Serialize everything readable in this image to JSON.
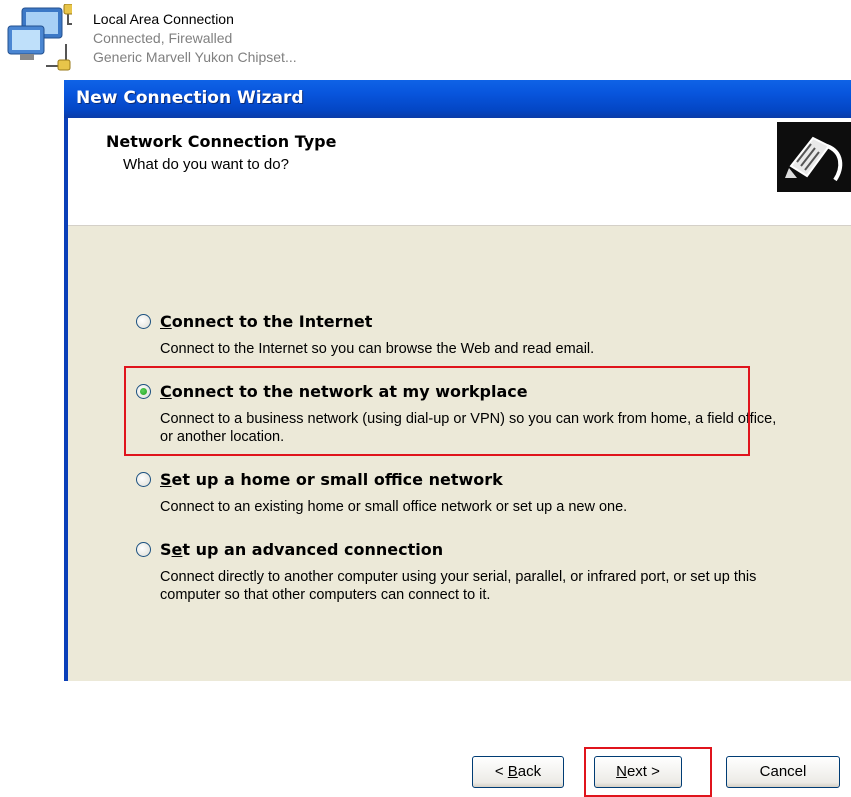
{
  "connection": {
    "name": "Local Area Connection",
    "status": "Connected, Firewalled",
    "adapter": "Generic Marvell Yukon Chipset..."
  },
  "wizard": {
    "title": "New Connection Wizard",
    "header_title": "Network Connection Type",
    "header_subtitle": "What do you want to do?",
    "options": [
      {
        "label_pre": "",
        "label_key": "C",
        "label_post": "onnect to the Internet",
        "desc": "Connect to the Internet so you can browse the Web and read email.",
        "selected": false
      },
      {
        "label_pre": "",
        "label_key": "C",
        "label_post": "onnect to the network at my workplace",
        "desc": "Connect to a business network (using dial-up or VPN) so you can work from home, a field office, or another location.",
        "selected": true
      },
      {
        "label_pre": "",
        "label_key": "S",
        "label_post": "et up a home or small office network",
        "desc": "Connect to an existing home or small office network or set up a new one.",
        "selected": false
      },
      {
        "label_pre": "S",
        "label_key": "e",
        "label_post": "t up an advanced connection",
        "desc": "Connect directly to another computer using your serial, parallel, or infrared port, or set up this computer so that other computers can connect to it.",
        "selected": false
      }
    ],
    "buttons": {
      "back_pre": "< ",
      "back_key": "B",
      "back_post": "ack",
      "next_key": "N",
      "next_post": "ext >",
      "cancel": "Cancel"
    }
  },
  "colors": {
    "title_bar": "#0855dd",
    "highlight": "#e0141c",
    "panel": "#ece9d8"
  }
}
